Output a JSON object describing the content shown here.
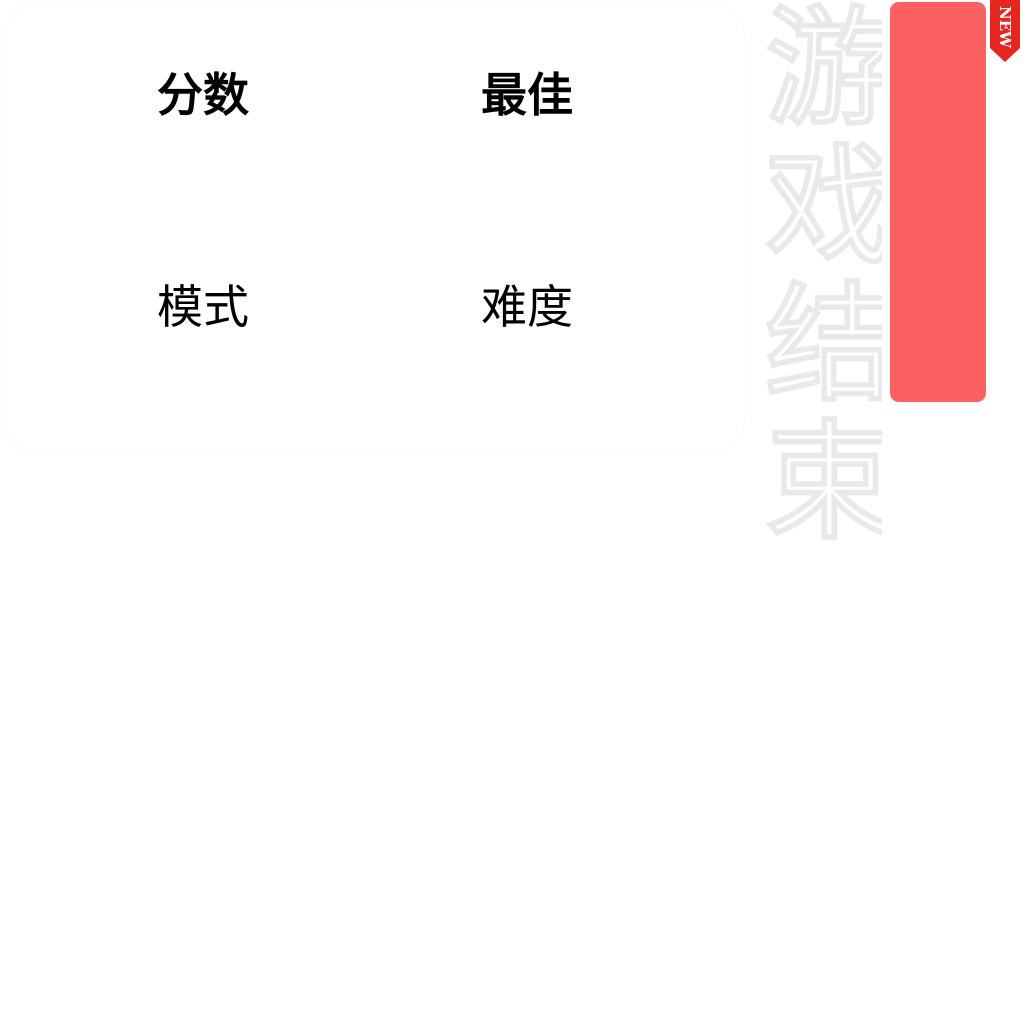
{
  "stats": {
    "score_label": "分数",
    "best_label": "最佳",
    "mode_label": "模式",
    "difficulty_label": "难度"
  },
  "title": "游戏结束",
  "ribbon": {
    "text": "NEW",
    "color": "#e52620"
  },
  "colors": {
    "panel": "#ffffff",
    "button": "#fc6161",
    "ribbon": "#e52620"
  }
}
